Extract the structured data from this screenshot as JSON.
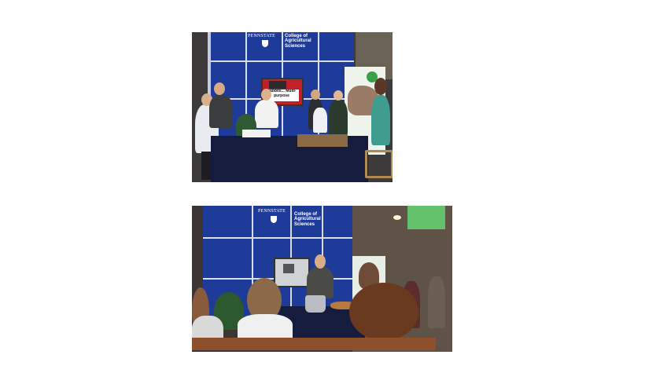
{
  "photos": [
    {
      "id_label": "top",
      "booth": {
        "logo_text": "PENNSTATE",
        "heading": "College of Agricultural Sciences"
      },
      "tv_caption": "Rabbits... Multi-purpose"
    },
    {
      "id_label": "bottom",
      "booth": {
        "logo_text": "PENNSTATE",
        "heading": "College of Agricultural Sciences"
      }
    }
  ],
  "colors": {
    "booth_blue": "#1f3b9a",
    "panel_line": "#d9dde8",
    "table_cloth": "#151c3d",
    "banner_green": "#62c16a"
  }
}
